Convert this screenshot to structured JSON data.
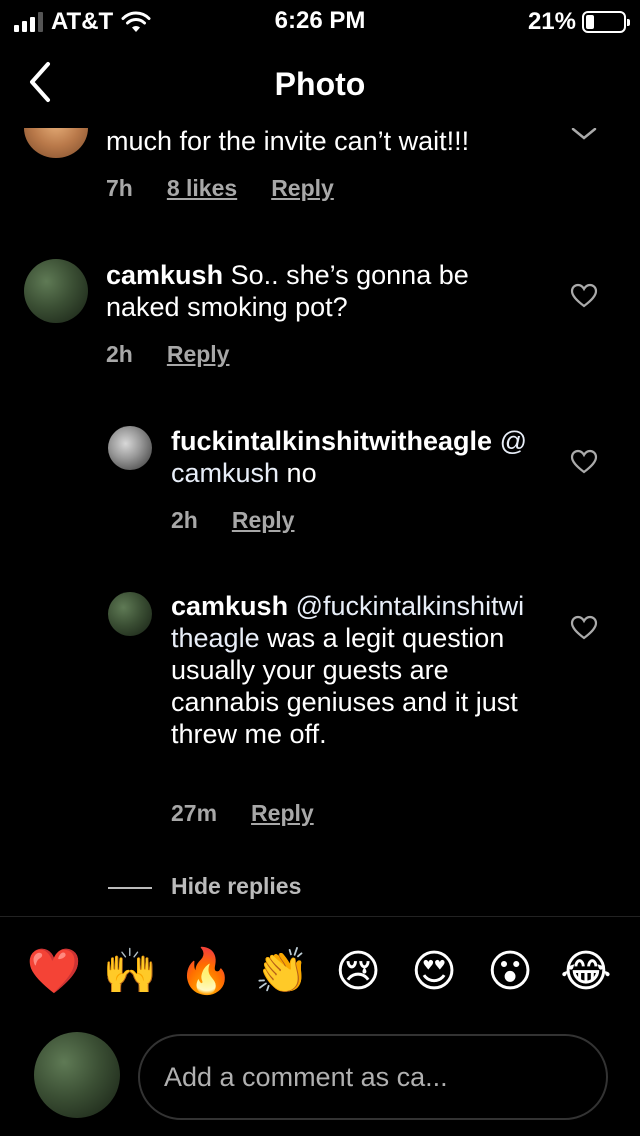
{
  "status": {
    "carrier": "AT&T",
    "time": "6:26 PM",
    "battery": "21%"
  },
  "nav": {
    "title": "Photo"
  },
  "comments": {
    "partial": {
      "text": "much for the invite can’t wait!!!",
      "time": "7h",
      "likes": "8 likes",
      "reply": "Reply"
    },
    "c1": {
      "user": "camkush",
      "text": " So.. she’s gonna be naked smoking pot?",
      "time": "2h",
      "reply": "Reply"
    },
    "r1": {
      "user": "fuckintalkinshitwitheagle",
      "mention": "@camkush",
      "text": " no",
      "time": "2h",
      "reply": "Reply"
    },
    "r2": {
      "user": "camkush",
      "mention": "@fuckintalkinshitwitheagle",
      "text": " was a legit question usually your guests are cannabis geniuses and it just threw me off.",
      "time": "27m",
      "reply": "Reply"
    },
    "hide_replies": "Hide replies"
  },
  "emojis": [
    "❤️",
    "🙌",
    "🔥",
    "👏",
    "😢",
    "😍",
    "😮",
    "😂"
  ],
  "compose": {
    "placeholder": "Add a comment as ca..."
  }
}
